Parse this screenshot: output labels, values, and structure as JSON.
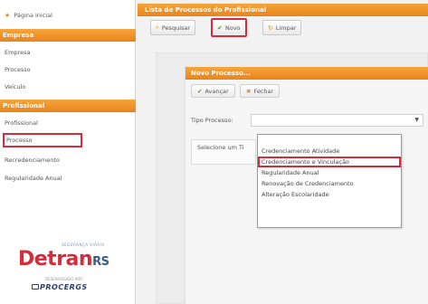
{
  "sidebar": {
    "home": "Página inicial",
    "sections": [
      {
        "title": "Empresa",
        "items": [
          "Empresa",
          "Processo",
          "Veículo"
        ]
      },
      {
        "title": "Profissional",
        "items": [
          "Profissional",
          "Processo",
          "Recredenciamento",
          "Regularidade Anual"
        ]
      }
    ],
    "logo": {
      "tagline_top": "SEGURANÇA VIÁRIA",
      "brand_main": "Detran",
      "brand_suffix": "RS",
      "tagline_bottom": "DESENVOLVIDO POR",
      "developer": "PROCERGS"
    }
  },
  "main": {
    "title": "Lista de Processos do Profissional",
    "toolbar": {
      "pesquisar": "Pesquisar",
      "novo": "Novo",
      "limpar": "Limpar"
    }
  },
  "dialog": {
    "title": "Novo Processo...",
    "avancar": "Avançar",
    "fechar": "Fechar",
    "tipo_label": "Tipo Processo:",
    "selecione": "Selecione um Ti"
  },
  "dropdown": {
    "options": [
      "",
      "Credenciamento Atividade",
      "Credenciamento e Vinculação",
      "Regularidade Anual",
      "Renovação de Credenciamento",
      "Alteração Escolaridade"
    ],
    "highlighted_index": 2
  },
  "colors": {
    "orange_header": "#e8841a",
    "highlight_red": "#d62b3a"
  }
}
